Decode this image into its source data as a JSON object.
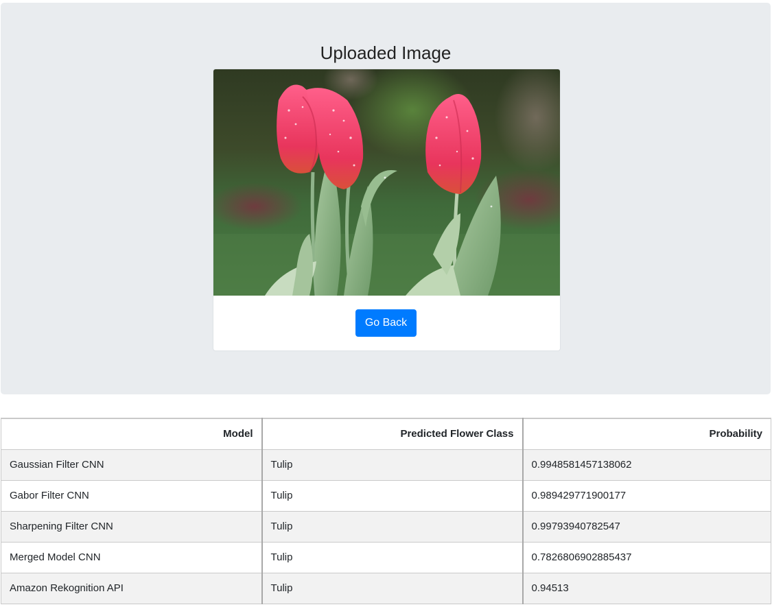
{
  "page": {
    "title": "Uploaded Image"
  },
  "image_card": {
    "image_alt": "Uploaded flower image",
    "button_label": "Go Back"
  },
  "results": {
    "headers": [
      "Model",
      "Predicted Flower Class",
      "Probability"
    ],
    "rows": [
      [
        "Gaussian Filter CNN",
        "Tulip",
        "0.9948581457138062"
      ],
      [
        "Gabor Filter CNN",
        "Tulip",
        "0.989429771900177"
      ],
      [
        "Sharpening Filter CNN",
        "Tulip",
        "0.99793940782547"
      ],
      [
        "Merged Model CNN",
        "Tulip",
        "0.7826806902885437"
      ],
      [
        "Amazon Rekognition API",
        "Tulip",
        "0.94513"
      ]
    ]
  },
  "colors": {
    "jumbotron_bg": "#e9ecef",
    "button_primary": "#007bff",
    "table_stripe": "#f2f2f2"
  }
}
